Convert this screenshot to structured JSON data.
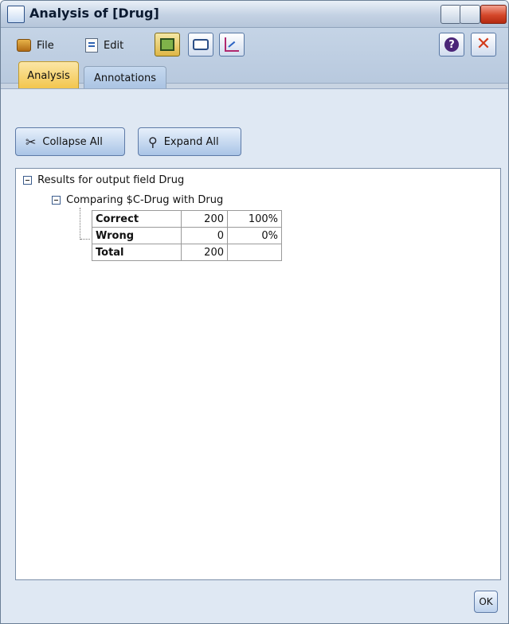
{
  "window": {
    "title": "Analysis of [Drug]"
  },
  "toolbar": {
    "file_label": "File",
    "edit_label": "Edit"
  },
  "tabs": [
    {
      "label": "Analysis",
      "active": true
    },
    {
      "label": "Annotations",
      "active": false
    }
  ],
  "actions": {
    "collapse_all": "Collapse All",
    "expand_all": "Expand All"
  },
  "tree": {
    "root_label": "Results for output field Drug",
    "child_label": "Comparing $C-Drug with Drug",
    "table": [
      {
        "label": "Correct",
        "count": "200",
        "percent": "100%"
      },
      {
        "label": "Wrong",
        "count": "0",
        "percent": "0%"
      },
      {
        "label": "Total",
        "count": "200",
        "percent": ""
      }
    ]
  },
  "footer": {
    "ok_label": "OK"
  },
  "icons": {
    "title_icon": "magnifier-icon",
    "file_icon": "folder-icon",
    "edit_icon": "document-edit-icon",
    "export_icon": "table-export-icon",
    "print_icon": "printer-icon",
    "chart_icon": "chart-icon",
    "help_icon": "help-icon",
    "close_icon": "close-icon",
    "collapse_icon": "collapse-icon",
    "expand_icon": "expand-icon"
  }
}
